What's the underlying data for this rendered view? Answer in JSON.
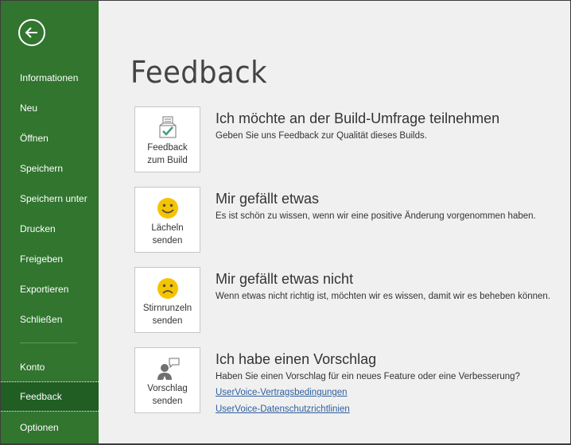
{
  "sidebar": {
    "back_icon": "arrow-left-circle-icon",
    "items": [
      {
        "label": "Informationen"
      },
      {
        "label": "Neu"
      },
      {
        "label": "Öffnen"
      },
      {
        "label": "Speichern"
      },
      {
        "label": "Speichern unter"
      },
      {
        "label": "Drucken"
      },
      {
        "label": "Freigeben"
      },
      {
        "label": "Exportieren"
      },
      {
        "label": "Schließen"
      },
      {
        "label": "Konto"
      },
      {
        "label": "Feedback",
        "active": true
      },
      {
        "label": "Optionen"
      }
    ],
    "accent": "#31752f",
    "active_bg": "#205e23"
  },
  "main": {
    "title": "Feedback",
    "sections": [
      {
        "tile_label_1": "Feedback",
        "tile_label_2": "zum Build",
        "icon": "feedback-ballot-check-icon",
        "title": "Ich möchte an der Build-Umfrage teilnehmen",
        "description": "Geben Sie uns Feedback zur Qualität dieses Builds."
      },
      {
        "tile_label_1": "Lächeln",
        "tile_label_2": "senden",
        "icon": "smile-face-icon",
        "title": "Mir gefällt etwas",
        "description": "Es ist schön zu wissen, wenn wir eine positive Änderung vorgenommen haben."
      },
      {
        "tile_label_1": "Stirnrunzeln",
        "tile_label_2": "senden",
        "icon": "frown-face-icon",
        "title": "Mir gefällt etwas nicht",
        "description": "Wenn etwas nicht richtig ist, möchten wir es wissen, damit wir es beheben können."
      },
      {
        "tile_label_1": "Vorschlag",
        "tile_label_2": "senden",
        "icon": "person-speech-bubble-icon",
        "title": "Ich habe einen Vorschlag",
        "description": "Haben Sie einen Vorschlag für ein neues Feature oder eine Verbesserung?",
        "links": [
          "UserVoice-Vertragsbedingungen",
          "UserVoice-Datenschutzrichtlinien"
        ]
      }
    ],
    "emoji_color": "#f5c400",
    "link_color": "#2e5f9e"
  }
}
